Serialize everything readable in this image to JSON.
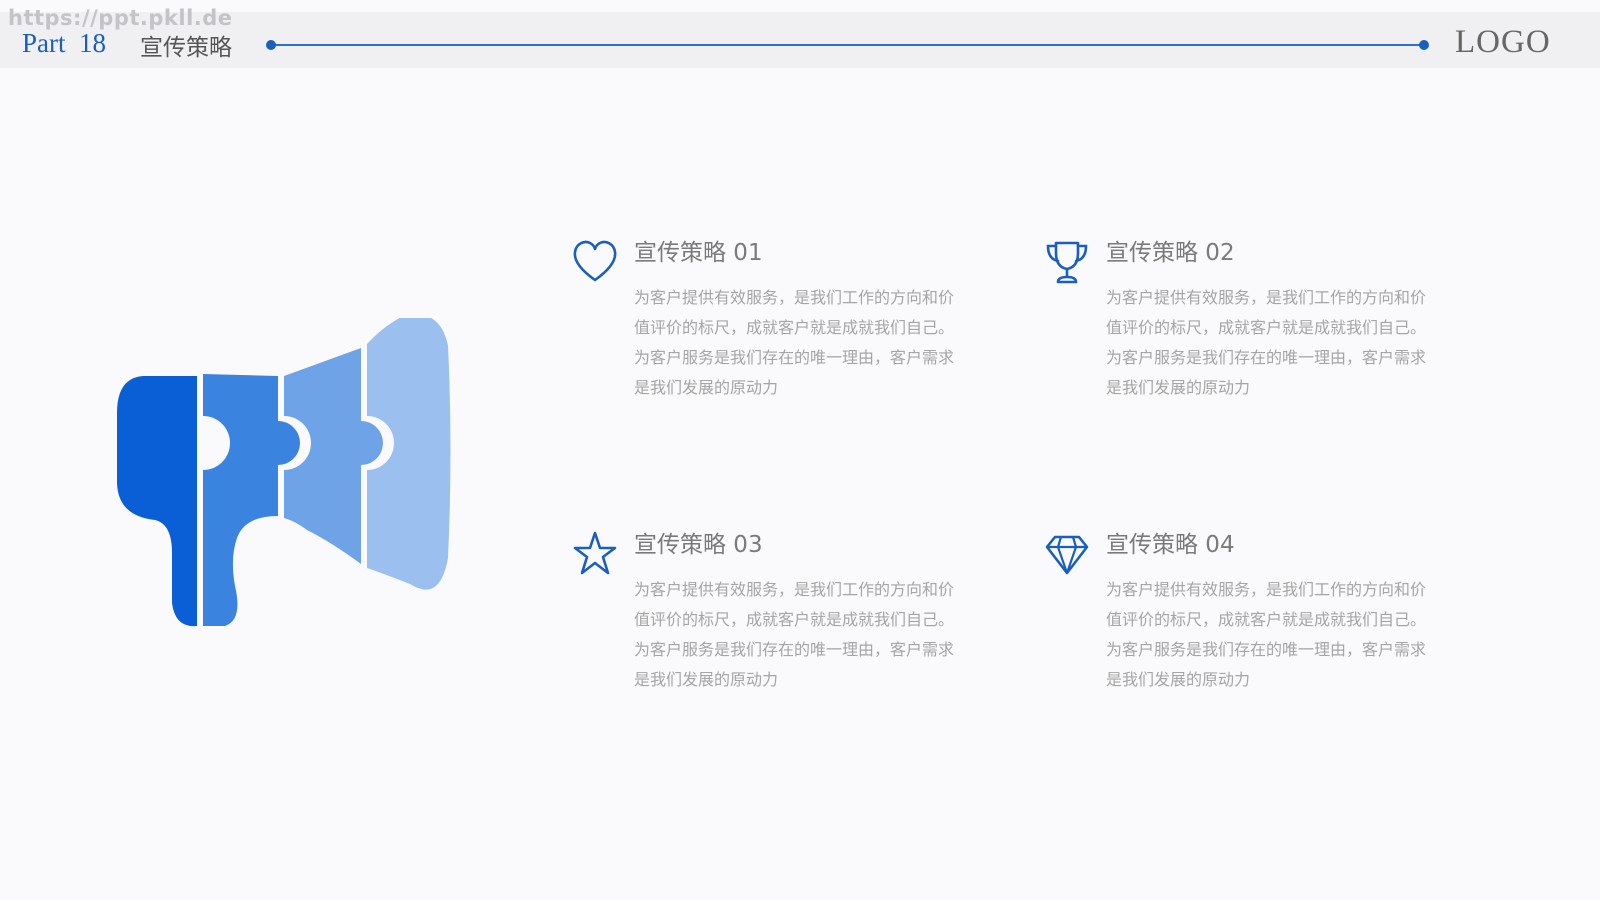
{
  "watermark": "https://ppt.pkll.de",
  "header": {
    "part": "Part  18",
    "section_title": "宣传策略",
    "logo": "LOGO"
  },
  "colors": {
    "primary": "#1a5fbd",
    "megaphone_segments": [
      "#0b5fd6",
      "#3a84e0",
      "#6ea3e8",
      "#9bbfee"
    ]
  },
  "items": [
    {
      "icon": "heart-icon",
      "title": "宣传策略 01",
      "desc": "为客户提供有效服务，是我们工作的方向和价值评价的标尺，成就客户就是成就我们自己。为客户服务是我们存在的唯一理由，客户需求是我们发展的原动力"
    },
    {
      "icon": "trophy-icon",
      "title": "宣传策略 02",
      "desc": "为客户提供有效服务，是我们工作的方向和价值评价的标尺，成就客户就是成就我们自己。为客户服务是我们存在的唯一理由，客户需求是我们发展的原动力"
    },
    {
      "icon": "star-icon",
      "title": "宣传策略 03",
      "desc": "为客户提供有效服务，是我们工作的方向和价值评价的标尺，成就客户就是成就我们自己。为客户服务是我们存在的唯一理由，客户需求是我们发展的原动力"
    },
    {
      "icon": "diamond-icon",
      "title": "宣传策略 04",
      "desc": "为客户提供有效服务，是我们工作的方向和价值评价的标尺，成就客户就是成就我们自己。为客户服务是我们存在的唯一理由，客户需求是我们发展的原动力"
    }
  ]
}
